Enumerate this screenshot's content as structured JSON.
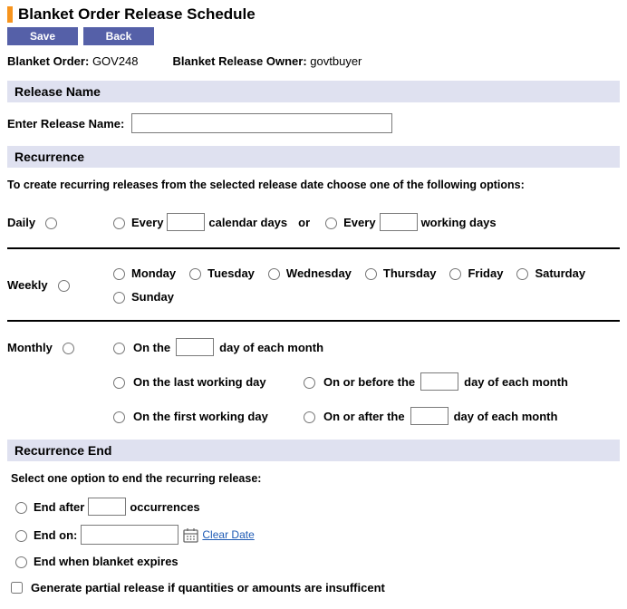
{
  "page_title": "Blanket Order Release Schedule",
  "toolbar": {
    "save": "Save",
    "back": "Back"
  },
  "info": {
    "blanket_order_label": "Blanket Order:",
    "blanket_order_value": "GOV248",
    "owner_label": "Blanket Release Owner:",
    "owner_value": "govtbuyer"
  },
  "sections": {
    "release_name": "Release Name",
    "recurrence": "Recurrence",
    "recurrence_end": "Recurrence End"
  },
  "release_name": {
    "label": "Enter Release Name:",
    "value": ""
  },
  "recurrence": {
    "instructions": "To create recurring releases from the selected release date choose one of the following options:",
    "daily": {
      "label": "Daily",
      "every_cal_prefix": "Every",
      "every_cal_suffix": "calendar days",
      "or": "or",
      "every_work_prefix": "Every",
      "every_work_suffix": "working days",
      "cal_value": "",
      "work_value": ""
    },
    "weekly": {
      "label": "Weekly",
      "days": [
        "Monday",
        "Tuesday",
        "Wednesday",
        "Thursday",
        "Friday",
        "Saturday",
        "Sunday"
      ]
    },
    "monthly": {
      "label": "Monthly",
      "on_the_prefix": "On the",
      "on_the_suffix": "day of each month",
      "on_the_value": "",
      "last_working": "On the last working day",
      "first_working": "On the first working day",
      "on_before_prefix": "On or before the",
      "on_before_suffix": "day of each month",
      "on_before_value": "",
      "on_after_prefix": "On or after the",
      "on_after_suffix": "day of each month",
      "on_after_value": ""
    }
  },
  "recurrence_end": {
    "instructions": "Select one option to end the recurring release:",
    "end_after_prefix": "End after",
    "end_after_suffix": "occurrences",
    "end_after_value": "",
    "end_on_label": "End on:",
    "end_on_value": "",
    "clear_date": "Clear Date",
    "end_when_expires": "End when blanket expires",
    "generate_partial": "Generate partial release if quantities or amounts are insufficent"
  }
}
